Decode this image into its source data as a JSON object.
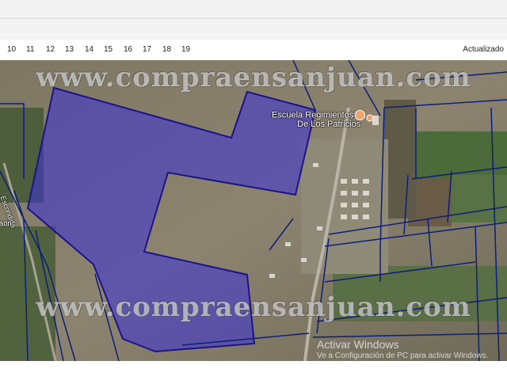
{
  "ruler": {
    "ticks": [
      "10",
      "11",
      "12",
      "13",
      "14",
      "15",
      "16",
      "17",
      "18",
      "19"
    ],
    "updated_label": "Actualizado"
  },
  "map": {
    "watermark_text": "www.compraensanjuan.com",
    "place_label_line1": "Escuela Regimientos",
    "place_label_line2": "De Los Patricios",
    "road_label": "Escondida",
    "road_label_left": "son",
    "highlight_color": "#3a2fd8",
    "parcel_line_color": "#0b1f78"
  },
  "windows_activation": {
    "title": "Activar Windows",
    "subtitle": "Ve a Configuración de PC para activar Windows."
  }
}
